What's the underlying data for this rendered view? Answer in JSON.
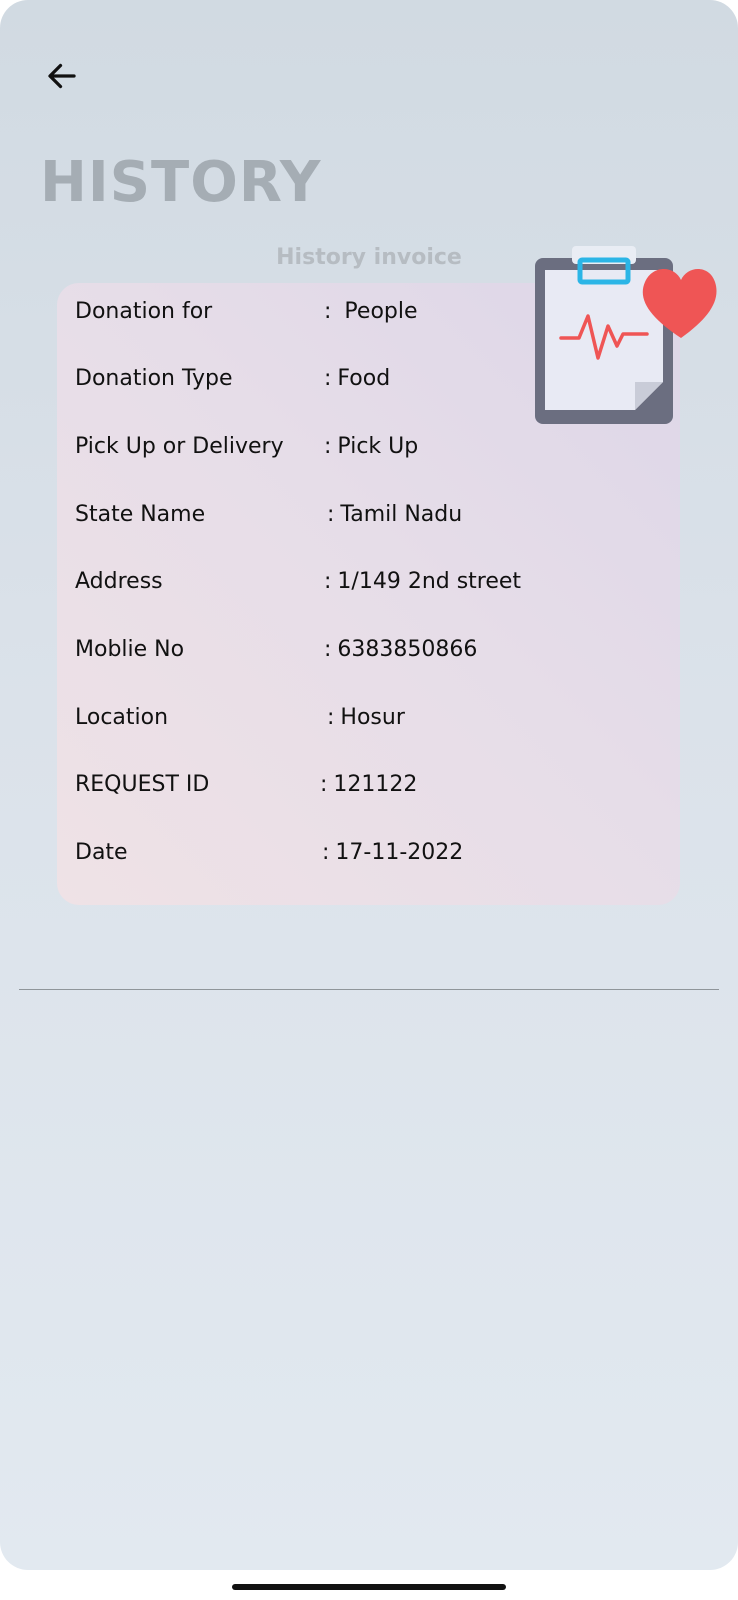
{
  "header": {
    "title": "HISTORY",
    "subtitle": "History invoice"
  },
  "invoice": {
    "rows": [
      {
        "label": "Donation for",
        "value": "People"
      },
      {
        "label": "Donation Type",
        "value": "Food"
      },
      {
        "label": "Pick Up or Delivery",
        "value": "Pick Up"
      },
      {
        "label": "State Name",
        "value": "Tamil Nadu"
      },
      {
        "label": "Address",
        "value": "1/149 2nd street"
      },
      {
        "label": "Moblie No",
        "value": "6383850866"
      },
      {
        "label": "Location",
        "value": "Hosur"
      },
      {
        "label": "REQUEST ID",
        "value": "121122"
      },
      {
        "label": "Date",
        "value": "17-11-2022"
      }
    ],
    "separator": ":"
  },
  "icons": {
    "back": "arrow-left-icon",
    "illustration": "medical-clipboard-heart-icon"
  },
  "colors": {
    "background": "#d1dae2",
    "title": "#a5adb4",
    "heart": "#ef5555",
    "clip_accent": "#2bb5e6"
  }
}
